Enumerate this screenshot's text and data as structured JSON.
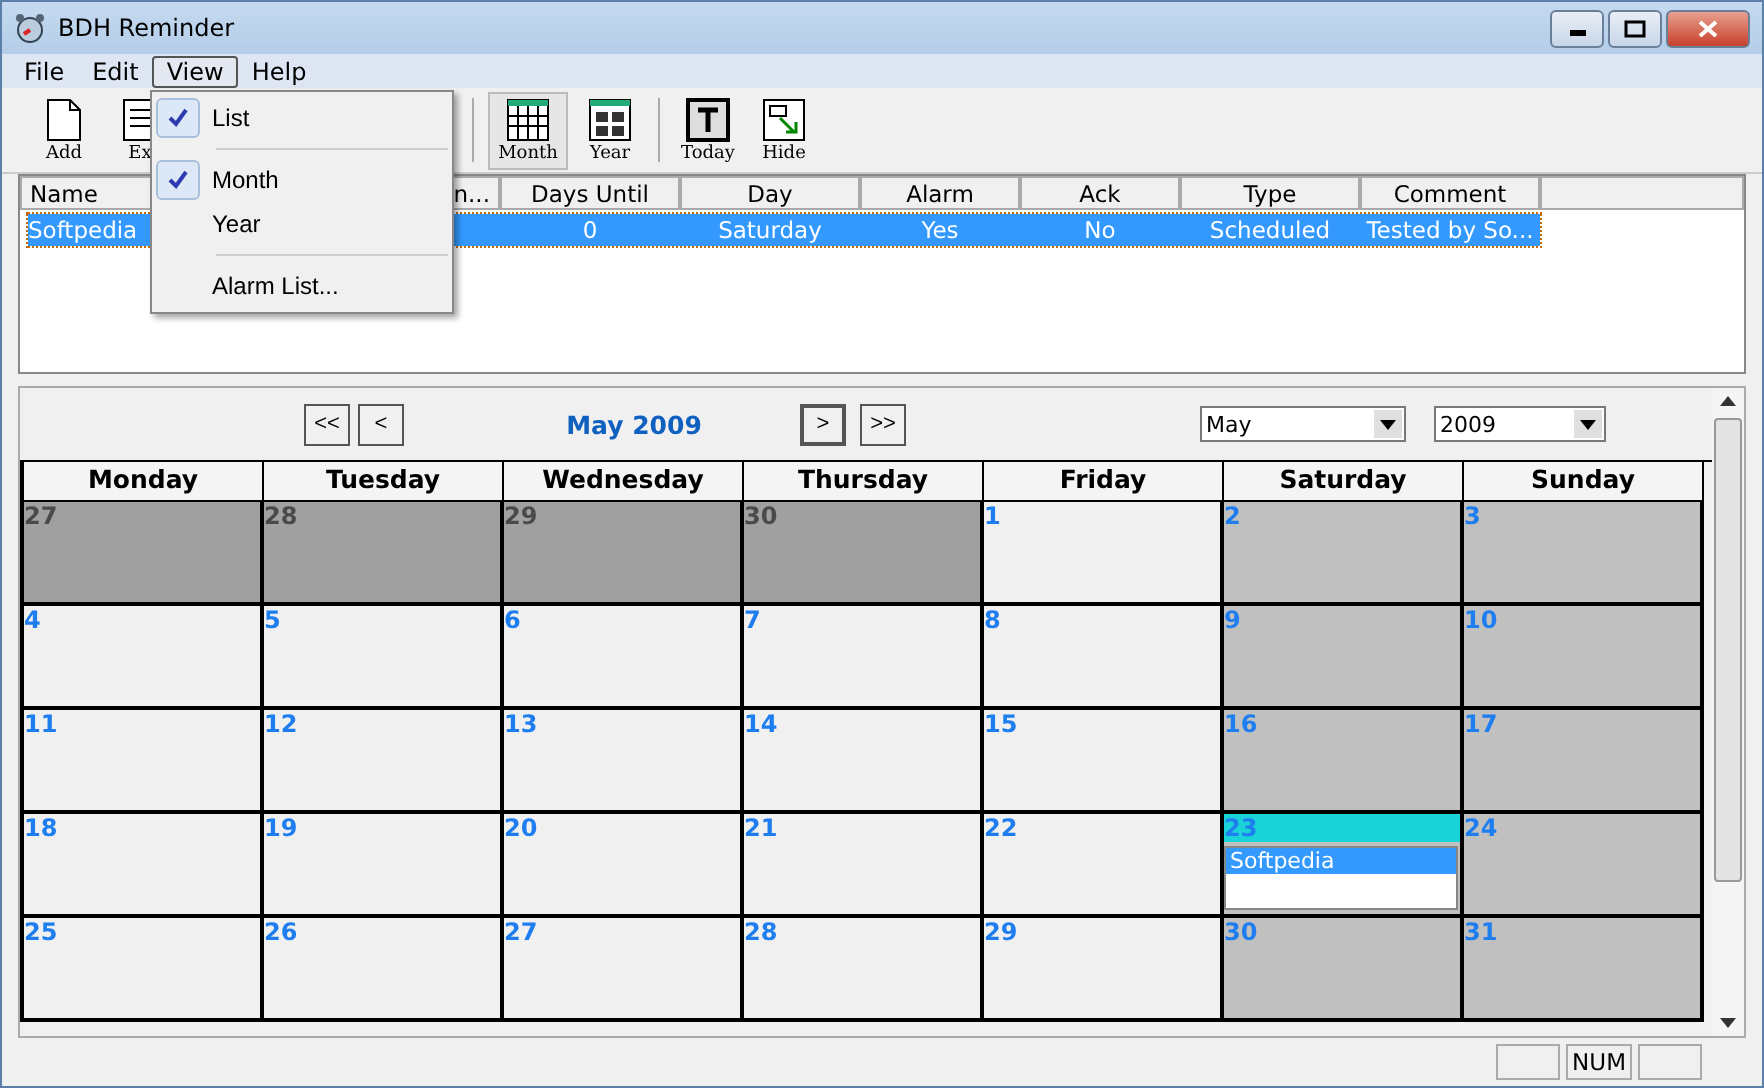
{
  "window": {
    "title": "BDH Reminder"
  },
  "menubar": [
    {
      "label": "File",
      "selected": false
    },
    {
      "label": "Edit",
      "selected": false
    },
    {
      "label": "View",
      "selected": true
    },
    {
      "label": "Help",
      "selected": false
    }
  ],
  "view_menu": [
    {
      "kind": "item",
      "label": "List",
      "checked": true
    },
    {
      "kind": "separator"
    },
    {
      "kind": "item",
      "label": "Month",
      "checked": true
    },
    {
      "kind": "item",
      "label": "Year",
      "checked": false
    },
    {
      "kind": "separator"
    },
    {
      "kind": "item",
      "label": "Alarm List...",
      "checked": false
    }
  ],
  "toolbar": [
    {
      "kind": "add",
      "label": "Add",
      "selected": false
    },
    {
      "kind": "edit",
      "label": "Ex",
      "selected": false
    },
    {
      "kind": "month",
      "label": "Month",
      "selected": true
    },
    {
      "kind": "year",
      "label": "Year",
      "selected": false
    },
    {
      "kind": "today",
      "label": "Today",
      "selected": false
    },
    {
      "kind": "hide",
      "label": "Hide",
      "selected": false
    }
  ],
  "list": {
    "columns": [
      "Name",
      "n...",
      "Days Until",
      "Day",
      "Alarm",
      "Ack",
      "Type",
      "Comment"
    ],
    "rows": [
      {
        "selected": true,
        "cells": [
          "Softpedia",
          "",
          "0",
          "Saturday",
          "Yes",
          "No",
          "Scheduled",
          "Tested by So..."
        ]
      }
    ]
  },
  "calendar": {
    "title": "May 2009",
    "month_select": "May",
    "year_select": "2009",
    "nav": [
      "<<",
      "<",
      ">",
      ">>"
    ],
    "weekdays": [
      "Monday",
      "Tuesday",
      "Wednesday",
      "Thursday",
      "Friday",
      "Saturday",
      "Sunday"
    ],
    "days": [
      {
        "day": "27",
        "kind": "outside"
      },
      {
        "day": "28",
        "kind": "outside"
      },
      {
        "day": "29",
        "kind": "outside"
      },
      {
        "day": "30",
        "kind": "outside"
      },
      {
        "day": "1",
        "kind": "weekday"
      },
      {
        "day": "2",
        "kind": "weekend"
      },
      {
        "day": "3",
        "kind": "weekend"
      },
      {
        "day": "4",
        "kind": "weekday"
      },
      {
        "day": "5",
        "kind": "weekday"
      },
      {
        "day": "6",
        "kind": "weekday"
      },
      {
        "day": "7",
        "kind": "weekday"
      },
      {
        "day": "8",
        "kind": "weekday"
      },
      {
        "day": "9",
        "kind": "weekend"
      },
      {
        "day": "10",
        "kind": "weekend"
      },
      {
        "day": "11",
        "kind": "weekday"
      },
      {
        "day": "12",
        "kind": "weekday"
      },
      {
        "day": "13",
        "kind": "weekday"
      },
      {
        "day": "14",
        "kind": "weekday"
      },
      {
        "day": "15",
        "kind": "weekday"
      },
      {
        "day": "16",
        "kind": "weekend"
      },
      {
        "day": "17",
        "kind": "weekend"
      },
      {
        "day": "18",
        "kind": "weekday"
      },
      {
        "day": "19",
        "kind": "weekday"
      },
      {
        "day": "20",
        "kind": "weekday"
      },
      {
        "day": "21",
        "kind": "weekday"
      },
      {
        "day": "22",
        "kind": "weekday"
      },
      {
        "day": "23",
        "kind": "weekend",
        "today": true,
        "entries": [
          {
            "label": "Softpedia",
            "selected": true
          }
        ]
      },
      {
        "day": "24",
        "kind": "weekend"
      },
      {
        "day": "25",
        "kind": "weekday"
      },
      {
        "day": "26",
        "kind": "weekday"
      },
      {
        "day": "27",
        "kind": "weekday"
      },
      {
        "day": "28",
        "kind": "weekday"
      },
      {
        "day": "29",
        "kind": "weekday"
      },
      {
        "day": "30",
        "kind": "weekend"
      },
      {
        "day": "31",
        "kind": "weekend"
      }
    ]
  },
  "status_bar": [
    "NUM"
  ]
}
